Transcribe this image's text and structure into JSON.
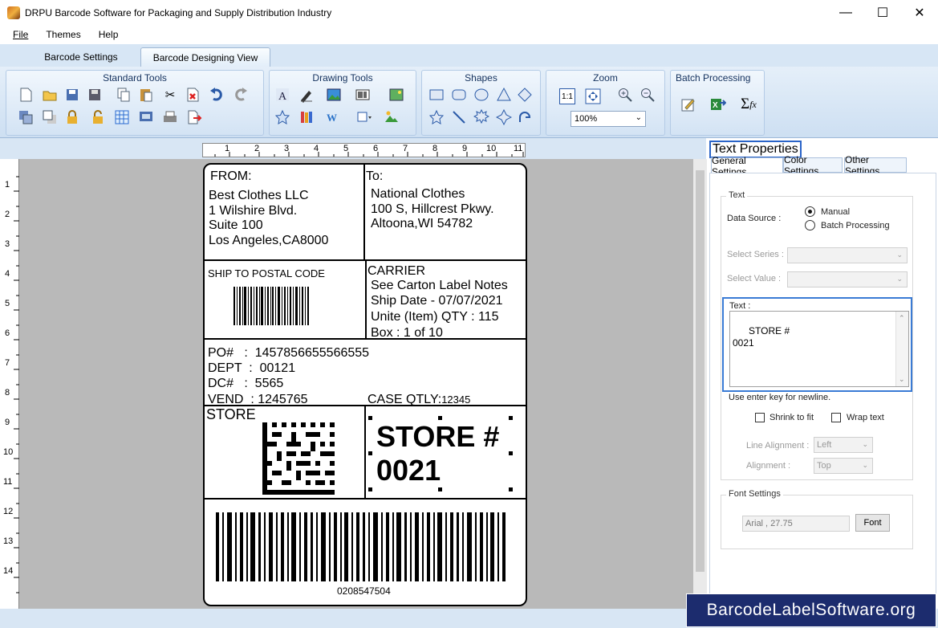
{
  "window": {
    "title": "DRPU Barcode Software for Packaging and Supply Distribution Industry"
  },
  "menu": [
    "File",
    "Themes",
    "Help"
  ],
  "tabs": [
    "Barcode Settings",
    "Barcode Designing View"
  ],
  "ribbon": {
    "groups": [
      "Standard Tools",
      "Drawing Tools",
      "Shapes",
      "Zoom",
      "Batch Processing"
    ],
    "zoom_value": "100%",
    "zoom_one_to_one": "1:1"
  },
  "ruler": {
    "h": [
      "1",
      "2",
      "3",
      "4",
      "5",
      "6",
      "7",
      "8",
      "9",
      "10",
      "11"
    ],
    "v": [
      "1",
      "2",
      "3",
      "4",
      "5",
      "6",
      "7",
      "8",
      "9",
      "10",
      "11",
      "12",
      "13",
      "14"
    ]
  },
  "label": {
    "from_heading": "FROM:",
    "from_lines": [
      "Best Clothes LLC",
      "1 Wilshire Blvd.",
      "Suite 100",
      "Los Angeles,CA8000"
    ],
    "to_heading": "To:",
    "to_lines": [
      "National Clothes",
      "100 S, Hillcrest Pkwy.",
      "Altoona,WI 54782"
    ],
    "ship_to_postal": "SHIP TO POSTAL CODE",
    "carrier_heading": "CARRIER",
    "carrier_lines": [
      "See Carton Label Notes",
      "Ship Date - 07/07/2021",
      "Unite (Item) QTY : 115",
      "Box : 1 of 10"
    ],
    "po_lines": [
      "PO#   :  1457856655566555",
      "DEPT  :  00121",
      "DC#   :  5565",
      "VEND  : 1245765"
    ],
    "case_qty_label": "CASE QTLY:",
    "case_qty_value": "12345",
    "store_label": "STORE",
    "store_big_line1": "STORE #",
    "store_big_line2": "0021",
    "barcode_number": "0208547504"
  },
  "props": {
    "title": "Text Properties",
    "tabs": [
      "General Settings",
      "Color Settings",
      "Other Settings"
    ],
    "text_legend": "Text",
    "data_source_label": "Data Source :",
    "manual": "Manual",
    "batch": "Batch Processing",
    "select_series": "Select Series :",
    "select_value": "Select Value :",
    "text_label": "Text :",
    "text_value": "STORE #\n0021",
    "hint": "Use enter key for newline.",
    "shrink": "Shrink to fit",
    "wrap": "Wrap text",
    "line_alignment_label": "Line Alignment :",
    "line_alignment_value": "Left",
    "alignment_label": "Alignment :",
    "alignment_value": "Top",
    "font_legend": "Font Settings",
    "font_value": "Arial , 27.75",
    "font_button": "Font"
  },
  "watermark": "BarcodeLabelSoftware.org"
}
